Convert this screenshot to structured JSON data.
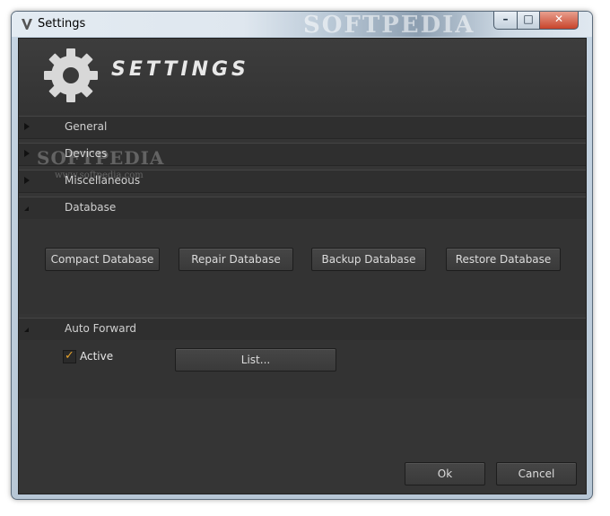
{
  "window": {
    "title": "Settings",
    "watermark": "SOFTPEDIA",
    "controls": {
      "minimize": "–",
      "maximize": "□",
      "close": "✕"
    }
  },
  "header": {
    "title": "SETTINGS",
    "icon": "gear-icon"
  },
  "sections": [
    {
      "label": "General",
      "state": "collapsed"
    },
    {
      "label": "Devices",
      "state": "collapsed"
    },
    {
      "label": "Miscellaneous",
      "state": "collapsed"
    },
    {
      "label": "Database",
      "state": "expanded"
    },
    {
      "label": "Auto Forward",
      "state": "expanded"
    }
  ],
  "database": {
    "compact": "Compact Database",
    "repair": "Repair Database",
    "backup": "Backup Database",
    "restore": "Restore Database"
  },
  "auto_forward": {
    "active_label": "Active",
    "active_checked": true,
    "list_button": "List..."
  },
  "footer": {
    "ok": "Ok",
    "cancel": "Cancel"
  },
  "overlay_watermark": {
    "brand": "SOFTPEDIA",
    "url": "www.softpedia.com"
  },
  "colors": {
    "background": "#353535",
    "check": "#e5a12a",
    "text": "#d0d0d0"
  }
}
